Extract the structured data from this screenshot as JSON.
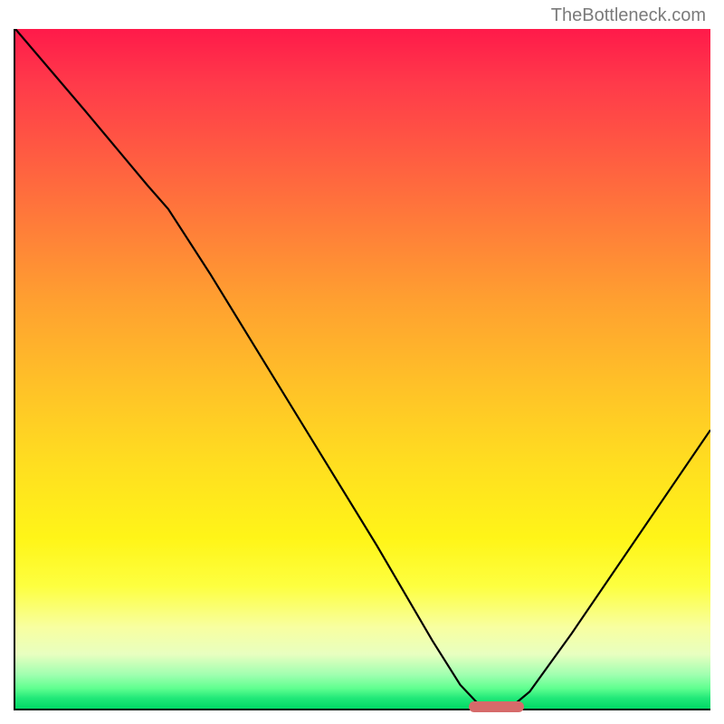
{
  "attribution": "TheBottleneck.com",
  "chart_data": {
    "type": "line",
    "title": "",
    "xlabel": "",
    "ylabel": "",
    "x_range_pct": [
      0,
      100
    ],
    "y_range_pct": [
      0,
      100
    ],
    "curve_points_pct": [
      [
        0,
        100
      ],
      [
        10,
        88
      ],
      [
        19,
        77
      ],
      [
        22,
        73.5
      ],
      [
        28,
        64
      ],
      [
        40,
        44
      ],
      [
        52,
        24
      ],
      [
        60,
        10
      ],
      [
        64,
        3.5
      ],
      [
        66.5,
        0.8
      ],
      [
        72,
        0.8
      ],
      [
        74,
        2.5
      ],
      [
        80,
        11
      ],
      [
        90,
        26
      ],
      [
        100,
        41
      ]
    ],
    "optimum_range_pct": [
      65,
      73
    ],
    "gradient_stops": [
      {
        "pos": 0,
        "color": "#ff1a4a"
      },
      {
        "pos": 25,
        "color": "#ff7a3a"
      },
      {
        "pos": 50,
        "color": "#ffc028"
      },
      {
        "pos": 75,
        "color": "#fff518"
      },
      {
        "pos": 95,
        "color": "#a0ffb0"
      },
      {
        "pos": 100,
        "color": "#00d865"
      }
    ]
  }
}
